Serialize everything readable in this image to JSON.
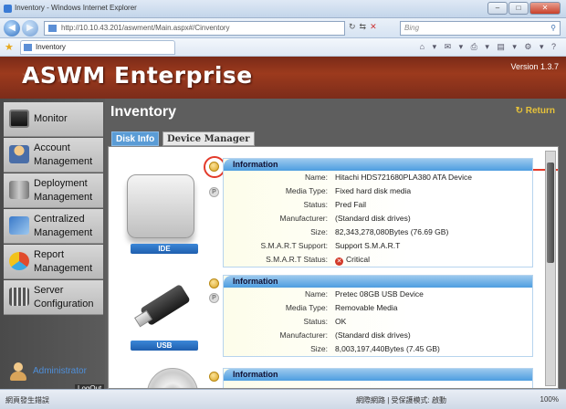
{
  "browser": {
    "title": "Inventory - Windows Internet Explorer",
    "url": "http://10.10.43.201/aswment/Main.aspx#/Cinventory",
    "search_placeholder": "Bing",
    "tab_label": "Inventory",
    "status_left": "網頁發生錯誤",
    "status_mid": "網際網路 | 受保護模式: 啟動",
    "zoom": "100%"
  },
  "app": {
    "name": "ASWM Enterprise",
    "version": "Version 1.3.7"
  },
  "sidebar": {
    "items": [
      {
        "label": "Monitor"
      },
      {
        "label": "Account Management"
      },
      {
        "label": "Deployment Management"
      },
      {
        "label": "Centralized Management"
      },
      {
        "label": "Report Management"
      },
      {
        "label": "Server Configuration"
      }
    ],
    "user": "Administrator",
    "logout": "LogOut"
  },
  "main": {
    "title": "Inventory",
    "return_label": "Return",
    "tabs": [
      {
        "label": "Disk Info",
        "active": true
      },
      {
        "label": "Device Manager",
        "active": false
      }
    ]
  },
  "devices": [
    {
      "caption": "IDE",
      "section_title": "Information",
      "rows": [
        {
          "key": "Name:",
          "value": "Hitachi HDS721680PLA380 ATA Device"
        },
        {
          "key": "Media Type:",
          "value": "Fixed hard disk media"
        },
        {
          "key": "Status:",
          "value": "Pred Fail"
        },
        {
          "key": "Manufacturer:",
          "value": "(Standard disk drives)"
        },
        {
          "key": "Size:",
          "value": "82,343,278,080Bytes (76.69 GB)"
        },
        {
          "key": "S.M.A.R.T Support:",
          "value": "Support S.M.A.R.T"
        },
        {
          "key": "S.M.A.R.T Status:",
          "value": "Critical"
        }
      ]
    },
    {
      "caption": "USB",
      "section_title": "Information",
      "rows": [
        {
          "key": "Name:",
          "value": "Pretec 08GB USB Device"
        },
        {
          "key": "Media Type:",
          "value": "Removable Media"
        },
        {
          "key": "Status:",
          "value": "OK"
        },
        {
          "key": "Manufacturer:",
          "value": "(Standard disk drives)"
        },
        {
          "key": "Size:",
          "value": "8,003,197,440Bytes (7.45 GB)"
        }
      ]
    },
    {
      "section_title": "Information"
    }
  ],
  "colors": {
    "header_bg": "#8a3119",
    "sidebar_bg": "#c9c9c9",
    "info_head": "#4d9de0",
    "accent_return": "#e6c23a",
    "critical": "#d23a2a",
    "highlight": "#e33a2a"
  }
}
